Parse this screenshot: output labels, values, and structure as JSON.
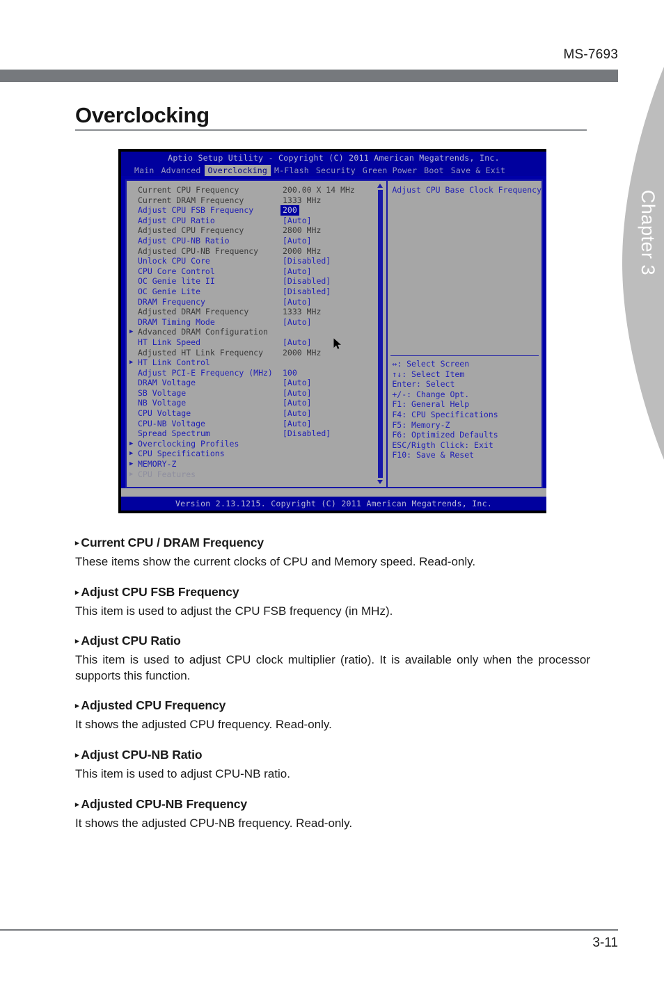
{
  "header": {
    "model_id": "MS-7693"
  },
  "chapter_tab": {
    "label": "Chapter 3"
  },
  "page_title": "Overclocking",
  "bios": {
    "title": "Aptio Setup Utility - Copyright (C) 2011 American Megatrends, Inc.",
    "tabs": [
      {
        "label": "Main",
        "active": false
      },
      {
        "label": "Advanced",
        "active": false
      },
      {
        "label": "Overclocking",
        "active": true
      },
      {
        "label": "M-Flash",
        "active": false
      },
      {
        "label": "Security",
        "active": false
      },
      {
        "label": "Green Power",
        "active": false
      },
      {
        "label": "Boot",
        "active": false
      },
      {
        "label": "Save & Exit",
        "active": false
      }
    ],
    "rows": [
      {
        "marker": "",
        "label": "Current CPU Frequency",
        "label_color": "dark",
        "value": "200.00 X 14 MHz",
        "value_color": "dark",
        "highlight": false
      },
      {
        "marker": "",
        "label": "Current DRAM Frequency",
        "label_color": "dark",
        "value": "1333 MHz",
        "value_color": "dark",
        "highlight": false
      },
      {
        "marker": "",
        "label": "Adjust CPU FSB Frequency",
        "label_color": "blue",
        "value": "200",
        "value_color": "hl",
        "highlight": true
      },
      {
        "marker": "",
        "label": "Adjust CPU Ratio",
        "label_color": "blue",
        "value": "[Auto]",
        "value_color": "blue",
        "highlight": false
      },
      {
        "marker": "",
        "label": "Adjusted CPU Frequency",
        "label_color": "dark",
        "value": "2800 MHz",
        "value_color": "dark",
        "highlight": false
      },
      {
        "marker": "",
        "label": "Adjust CPU-NB Ratio",
        "label_color": "blue",
        "value": "[Auto]",
        "value_color": "blue",
        "highlight": false
      },
      {
        "marker": "",
        "label": "Adjusted CPU-NB Frequency",
        "label_color": "dark",
        "value": "2000 MHz",
        "value_color": "dark",
        "highlight": false
      },
      {
        "marker": "",
        "label": "Unlock CPU Core",
        "label_color": "blue",
        "value": "[Disabled]",
        "value_color": "blue",
        "highlight": false
      },
      {
        "marker": "",
        "label": "CPU Core Control",
        "label_color": "blue",
        "value": "[Auto]",
        "value_color": "blue",
        "highlight": false
      },
      {
        "marker": "",
        "label": "OC Genie lite II",
        "label_color": "blue",
        "value": "[Disabled]",
        "value_color": "blue",
        "highlight": false
      },
      {
        "marker": "",
        "label": "OC Genie Lite",
        "label_color": "blue",
        "value": "[Disabled]",
        "value_color": "blue",
        "highlight": false
      },
      {
        "marker": "",
        "label": "DRAM Frequency",
        "label_color": "blue",
        "value": "[Auto]",
        "value_color": "blue",
        "highlight": false
      },
      {
        "marker": "",
        "label": "Adjusted DRAM Frequency",
        "label_color": "dark",
        "value": "1333 MHz",
        "value_color": "dark",
        "highlight": false
      },
      {
        "marker": "",
        "label": "DRAM Timing Mode",
        "label_color": "blue",
        "value": "[Auto]",
        "value_color": "blue",
        "highlight": false
      },
      {
        "marker": "▶",
        "label": "Advanced DRAM Configuration",
        "label_color": "dark",
        "value": "",
        "value_color": "dark",
        "highlight": false
      },
      {
        "marker": "",
        "label": "HT Link Speed",
        "label_color": "blue",
        "value": "[Auto]",
        "value_color": "blue",
        "highlight": false
      },
      {
        "marker": "",
        "label": "Adjusted HT Link Frequency",
        "label_color": "dark",
        "value": "2000 MHz",
        "value_color": "dark",
        "highlight": false
      },
      {
        "marker": "▶",
        "label": "HT Link Control",
        "label_color": "blue",
        "value": "",
        "value_color": "blue",
        "highlight": false
      },
      {
        "marker": "",
        "label": "Adjust PCI-E Frequency (MHz)",
        "label_color": "blue",
        "value": "100",
        "value_color": "blue",
        "highlight": false
      },
      {
        "marker": "",
        "label": "DRAM Voltage",
        "label_color": "blue",
        "value": "[Auto]",
        "value_color": "blue",
        "highlight": false
      },
      {
        "marker": "",
        "label": "SB Voltage",
        "label_color": "blue",
        "value": "[Auto]",
        "value_color": "blue",
        "highlight": false
      },
      {
        "marker": "",
        "label": "NB Voltage",
        "label_color": "blue",
        "value": "[Auto]",
        "value_color": "blue",
        "highlight": false
      },
      {
        "marker": "",
        "label": "CPU Voltage",
        "label_color": "blue",
        "value": "[Auto]",
        "value_color": "blue",
        "highlight": false
      },
      {
        "marker": "",
        "label": "CPU-NB Voltage",
        "label_color": "blue",
        "value": "[Auto]",
        "value_color": "blue",
        "highlight": false
      },
      {
        "marker": "",
        "label": "Spread Spectrum",
        "label_color": "blue",
        "value": "[Disabled]",
        "value_color": "blue",
        "highlight": false
      },
      {
        "marker": "▶",
        "label": "Overclocking Profiles",
        "label_color": "blue",
        "value": "",
        "value_color": "blue",
        "highlight": false
      },
      {
        "marker": "▶",
        "label": "CPU Specifications",
        "label_color": "blue",
        "value": "",
        "value_color": "blue",
        "highlight": false
      },
      {
        "marker": "▶",
        "label": "MEMORY-Z",
        "label_color": "blue",
        "value": "",
        "value_color": "blue",
        "highlight": false
      },
      {
        "marker": "▶",
        "label": "CPU Features",
        "label_color": "dim",
        "value": "",
        "value_color": "dim",
        "highlight": false
      }
    ],
    "help_text": "Adjust CPU Base Clock Frequency",
    "keys": [
      "↔: Select Screen",
      "↑↓: Select Item",
      "Enter: Select",
      "+/-: Change Opt.",
      "F1: General Help",
      "F4: CPU Specifications",
      "F5: Memory-Z",
      "F6: Optimized Defaults",
      "ESC/Rigth Click: Exit",
      "F10: Save & Reset"
    ],
    "footer": "Version 2.13.1215. Copyright (C) 2011 American Megatrends, Inc."
  },
  "sections": [
    {
      "bullet": "▸",
      "heading": "Current CPU / DRAM Frequency",
      "body": "These items show the current clocks of CPU and Memory speed. Read-only."
    },
    {
      "bullet": "▸",
      "heading": "Adjust CPU FSB Frequency",
      "body": "This item is used to adjust the CPU FSB frequency (in MHz)."
    },
    {
      "bullet": "▸",
      "heading": "Adjust CPU Ratio",
      "body": "This item is used to adjust CPU clock multiplier (ratio). It is available only when the processor supports this function."
    },
    {
      "bullet": "▸",
      "heading": "Adjusted CPU Frequency",
      "body": "It shows the adjusted CPU frequency. Read-only."
    },
    {
      "bullet": "▸",
      "heading": "Adjust CPU-NB Ratio",
      "body": "This item is used to adjust CPU-NB ratio."
    },
    {
      "bullet": "▸",
      "heading": "Adjusted CPU-NB Frequency",
      "body": "It shows the adjusted CPU-NB frequency. Read-only."
    }
  ],
  "footer": {
    "page_number": "3-11"
  },
  "colors": {
    "header_gray": "#76797d",
    "tab_gray": "#bdbdbd",
    "bios_blue": "#00009e",
    "bios_panel": "#a6a6a6",
    "bios_text_blue": "#2020b4"
  }
}
